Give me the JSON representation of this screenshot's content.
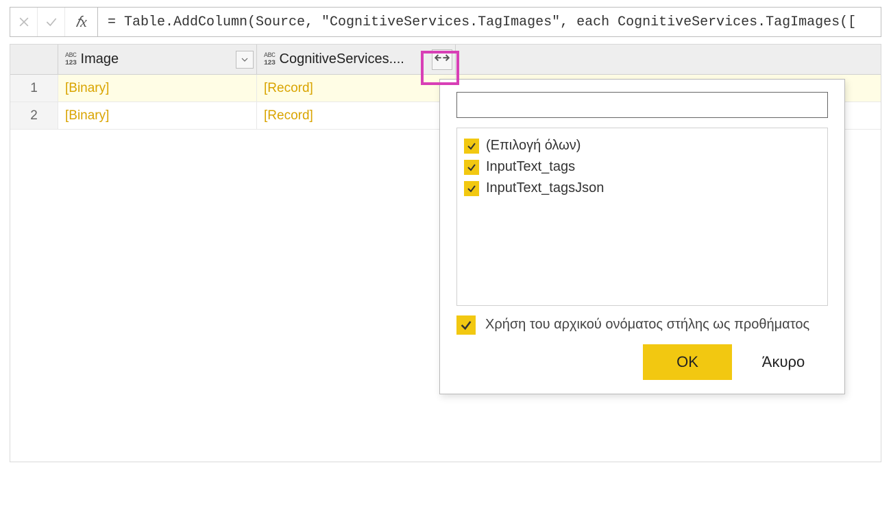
{
  "formula_bar": {
    "formula": "= Table.AddColumn(Source, \"CognitiveServices.TagImages\", each CognitiveServices.TagImages(["
  },
  "columns": {
    "col1": "Image",
    "col2": "CognitiveServices...."
  },
  "rows": [
    {
      "index": "1",
      "image": "[Binary]",
      "record": "[Record]"
    },
    {
      "index": "2",
      "image": "[Binary]",
      "record": "[Record]"
    }
  ],
  "popup": {
    "search_placeholder": "",
    "items": [
      {
        "label": "(Επιλογή όλων)"
      },
      {
        "label": "InputText_tags"
      },
      {
        "label": "InputText_tagsJson"
      }
    ],
    "prefix_label": "Χρήση του αρχικού ονόματος στήλης ως προθήματος",
    "ok_label": "OK",
    "cancel_label": "Άκυρο"
  }
}
